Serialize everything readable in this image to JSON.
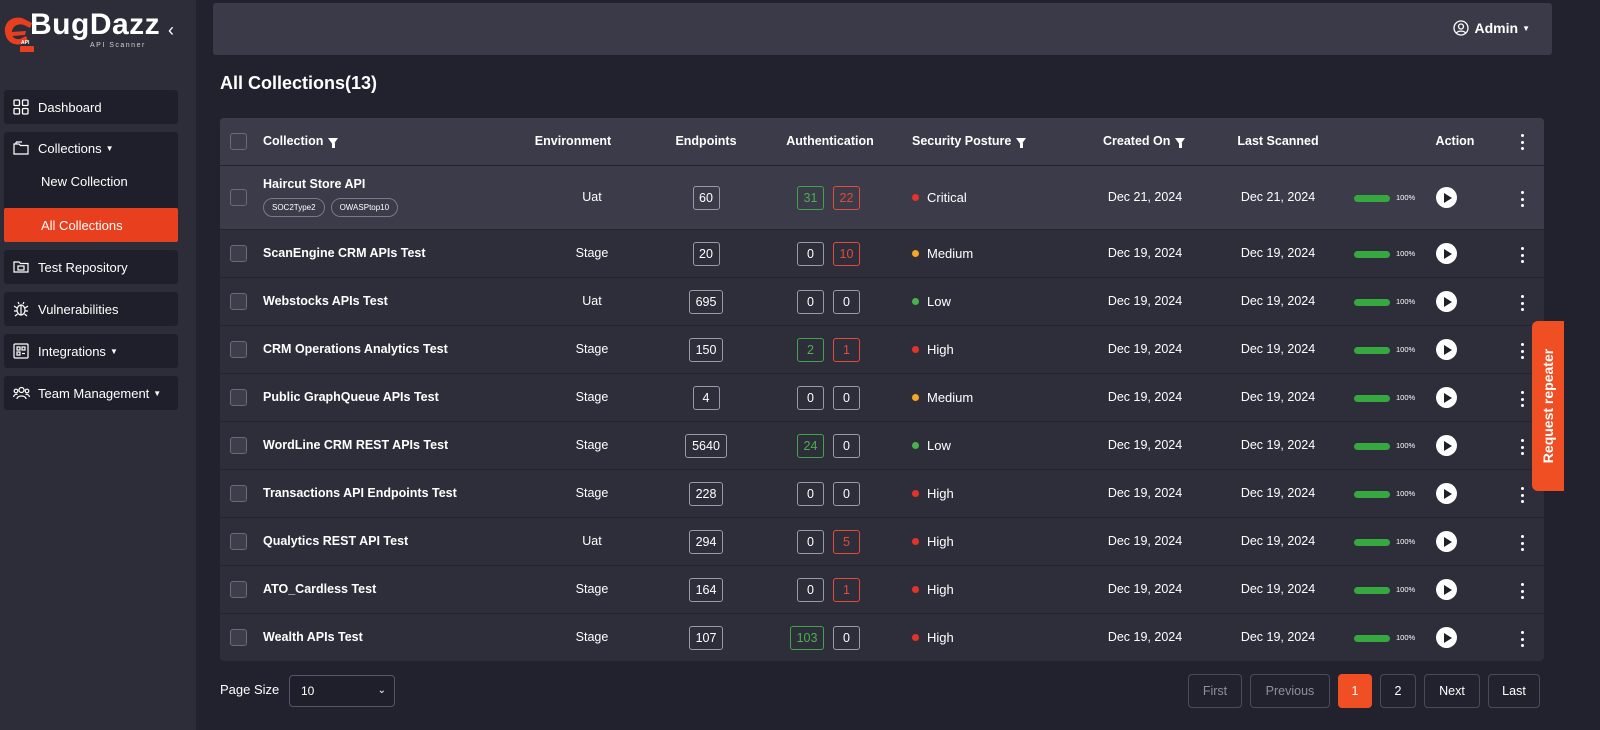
{
  "brand": {
    "name": "BugDazz",
    "subtitle": "API Scanner",
    "mark_label": "API",
    "accent": "#f04e23"
  },
  "sidebar": {
    "items": [
      {
        "label": "Dashboard",
        "icon": "grid-icon"
      },
      {
        "label": "Collections",
        "icon": "folder-icon",
        "children": [
          "New Collection",
          "All Collections"
        ]
      },
      {
        "label": "Test Repository",
        "icon": "repository-icon"
      },
      {
        "label": "Vulnerabilities",
        "icon": "bug-icon"
      },
      {
        "label": "Integrations",
        "icon": "integrations-icon"
      },
      {
        "label": "Team Management",
        "icon": "team-icon"
      }
    ]
  },
  "header": {
    "user": "Admin"
  },
  "page": {
    "title": "All Collections(13)"
  },
  "table": {
    "columns": [
      "Collection",
      "Environment",
      "Endpoints",
      "Authentication",
      "Security Posture",
      "Created On",
      "Last Scanned",
      "Action"
    ],
    "rows": [
      {
        "name": "Haircut Store API",
        "tags": [
          "SOC2Type2",
          "OWASPtop10"
        ],
        "env": "Uat",
        "endpoints": "60",
        "auth_pass": "31",
        "auth_fail": "22",
        "auth_pass_color": "green",
        "auth_fail_color": "red",
        "posture": "Critical",
        "posture_color": "#e5322d",
        "created": "Dec 21, 2024",
        "scanned": "Dec 21, 2024",
        "progress": "100%"
      },
      {
        "name": "ScanEngine CRM APIs Test",
        "env": "Stage",
        "endpoints": "20",
        "auth_pass": "0",
        "auth_fail": "10",
        "auth_pass_color": "neutral",
        "auth_fail_color": "red",
        "posture": "Medium",
        "posture_color": "#f5a623",
        "created": "Dec 19, 2024",
        "scanned": "Dec 19, 2024",
        "progress": "100%"
      },
      {
        "name": "Webstocks APIs Test",
        "env": "Uat",
        "endpoints": "695",
        "auth_pass": "0",
        "auth_fail": "0",
        "auth_pass_color": "neutral",
        "auth_fail_color": "neutral",
        "posture": "Low",
        "posture_color": "#4caf50",
        "created": "Dec 19, 2024",
        "scanned": "Dec 19, 2024",
        "progress": "100%"
      },
      {
        "name": "CRM Operations Analytics Test",
        "env": "Stage",
        "endpoints": "150",
        "auth_pass": "2",
        "auth_fail": "1",
        "auth_pass_color": "green",
        "auth_fail_color": "red",
        "posture": "High",
        "posture_color": "#e5322d",
        "created": "Dec 19, 2024",
        "scanned": "Dec 19, 2024",
        "progress": "100%"
      },
      {
        "name": "Public GraphQueue APIs Test",
        "env": "Stage",
        "endpoints": "4",
        "auth_pass": "0",
        "auth_fail": "0",
        "auth_pass_color": "neutral",
        "auth_fail_color": "neutral",
        "posture": "Medium",
        "posture_color": "#f5a623",
        "created": "Dec 19, 2024",
        "scanned": "Dec 19, 2024",
        "progress": "100%"
      },
      {
        "name": "WordLine CRM REST APIs Test",
        "env": "Stage",
        "endpoints": "5640",
        "auth_pass": "24",
        "auth_fail": "0",
        "auth_pass_color": "green",
        "auth_fail_color": "neutral",
        "posture": "Low",
        "posture_color": "#4caf50",
        "created": "Dec 19, 2024",
        "scanned": "Dec 19, 2024",
        "progress": "100%"
      },
      {
        "name": "Transactions API Endpoints Test",
        "env": "Stage",
        "endpoints": "228",
        "auth_pass": "0",
        "auth_fail": "0",
        "auth_pass_color": "neutral",
        "auth_fail_color": "neutral",
        "posture": "High",
        "posture_color": "#e5322d",
        "created": "Dec 19, 2024",
        "scanned": "Dec 19, 2024",
        "progress": "100%"
      },
      {
        "name": "Qualytics REST API Test",
        "env": "Uat",
        "endpoints": "294",
        "auth_pass": "0",
        "auth_fail": "5",
        "auth_pass_color": "neutral",
        "auth_fail_color": "red",
        "posture": "High",
        "posture_color": "#e5322d",
        "created": "Dec 19, 2024",
        "scanned": "Dec 19, 2024",
        "progress": "100%"
      },
      {
        "name": "ATO_Cardless Test",
        "env": "Stage",
        "endpoints": "164",
        "auth_pass": "0",
        "auth_fail": "1",
        "auth_pass_color": "neutral",
        "auth_fail_color": "red",
        "posture": "High",
        "posture_color": "#e5322d",
        "created": "Dec 19, 2024",
        "scanned": "Dec 19, 2024",
        "progress": "100%"
      },
      {
        "name": "Wealth APIs Test",
        "env": "Stage",
        "endpoints": "107",
        "auth_pass": "103",
        "auth_fail": "0",
        "auth_pass_color": "green",
        "auth_fail_color": "neutral",
        "posture": "High",
        "posture_color": "#e5322d",
        "created": "Dec 19, 2024",
        "scanned": "Dec 19, 2024",
        "progress": "100%"
      }
    ]
  },
  "footer": {
    "page_size_label": "Page Size",
    "page_size_value": "10",
    "pagination": [
      "First",
      "Previous",
      "1",
      "2",
      "Next",
      "Last"
    ],
    "current_page": "1"
  },
  "repeater": {
    "label": "Request repeater"
  }
}
